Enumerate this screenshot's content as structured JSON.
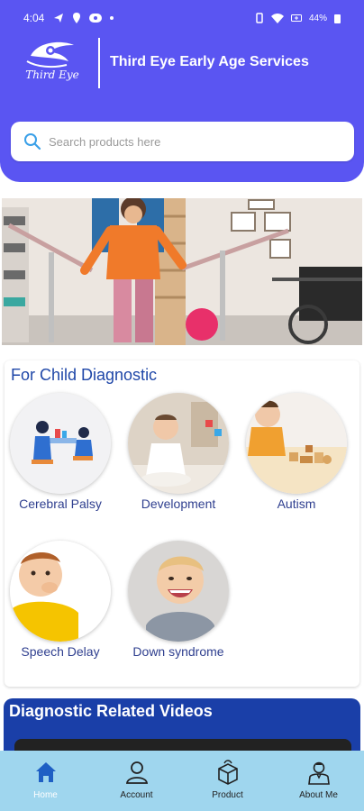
{
  "status_bar": {
    "time": "4:04",
    "battery": "44%"
  },
  "header": {
    "logo_text": "Third Eye",
    "title": "Third Eye Early Age Services",
    "background": "#5a55f2"
  },
  "search": {
    "placeholder": "Search products here"
  },
  "diagnostic": {
    "title": "For Child Diagnostic",
    "items": [
      {
        "label": "Cerebral Palsy"
      },
      {
        "label": "Development"
      },
      {
        "label": "Autism"
      },
      {
        "label": "Speech Delay"
      },
      {
        "label": "Down syndrome"
      }
    ]
  },
  "videos": {
    "title": "Diagnostic Related Videos"
  },
  "nav": {
    "items": [
      {
        "label": "Home",
        "icon": "home-icon",
        "active": true
      },
      {
        "label": "Account",
        "icon": "account-icon"
      },
      {
        "label": "Product",
        "icon": "product-icon"
      },
      {
        "label": "About Me",
        "icon": "about-icon"
      }
    ],
    "active_color": "#1e5fc4"
  }
}
